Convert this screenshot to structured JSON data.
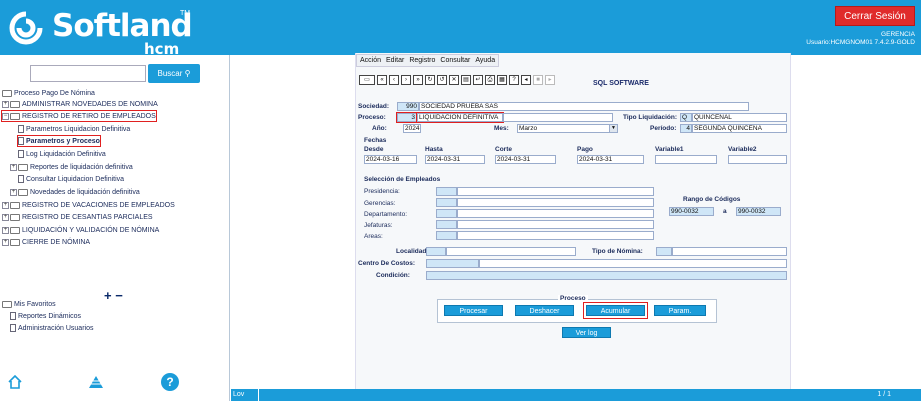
{
  "app": {
    "logo_text": "Softland",
    "logo_sub": "hcm",
    "logout": "Cerrar Sesión",
    "company": "GERENCIA",
    "user_line": "Usuario:HCMGNOM01 7.4.2.9-GOLD"
  },
  "sidebar": {
    "search_button": "Buscar",
    "root": "Proceso Pago De Nómina",
    "items": [
      "ADMINISTRAR NOVEDADES DE NOMINA",
      "REGISTRO DE RETIRO DE EMPLEADOS",
      "Parametros Liquidacion Definitiva",
      "Parametros y Proceso",
      "Log Liquidación Definitiva",
      "Reportes de liquidación definitiva",
      "Consultar Liquidacion Definitiva",
      "Novedades de liquidación definitiva",
      "REGISTRO DE VACACIONES DE EMPLEADOS",
      "REGISTRO DE CESANTIAS PARCIALES",
      "LIQUIDACIÓN Y VALIDACIÓN DE NÓMINA",
      "CIERRE DE NÓMINA"
    ],
    "favorites_title": "Mis Favoritos",
    "favorites": [
      "Reportes Dinámicos",
      "Administración Usuarios"
    ]
  },
  "menu": [
    "Acción",
    "Editar",
    "Registro",
    "Consultar",
    "Ayuda"
  ],
  "toolbar_title": "SQL SOFTWARE",
  "form": {
    "sociedad_label": "Sociedad:",
    "sociedad_code": "990",
    "sociedad_name": "SOCIEDAD  PRUEBA SAS",
    "proceso_label": "Proceso:",
    "proceso_code": "3",
    "proceso_name": "LIQUIDACION DEFINITIVA",
    "tipo_liq_label": "Tipo Liquidación:",
    "tipo_liq_code": "Q",
    "tipo_liq_name": "QUINCENAL",
    "anio_label": "Año:",
    "anio": "2024",
    "mes_label": "Mes:",
    "mes": "Marzo",
    "periodo_label": "Período:",
    "periodo_code": "4",
    "periodo_name": "SEGUNDA QUINCENA",
    "fechas_label": "Fechas",
    "desde_label": "Desde",
    "desde": "2024-03-16",
    "hasta_label": "Hasta",
    "hasta": "2024-03-31",
    "corte_label": "Corte",
    "corte": "2024-03-31",
    "pago_label": "Pago",
    "pago": "2024-03-31",
    "variable1_label": "Variable1",
    "variable2_label": "Variable2",
    "seleccion_label": "Selección de Empleados",
    "presidencia_label": "Presidencia:",
    "gerencias_label": "Gerencias:",
    "departamento_label": "Departamento:",
    "jefaturas_label": "Jefaturas:",
    "areas_label": "Areas:",
    "rango_label": "Rango de Códigos",
    "rango_desde": "990-0032",
    "rango_a": "a",
    "rango_hasta": "990-0032",
    "localidad_label": "Localidad:",
    "tipo_nomina_label": "Tipo de Nómina:",
    "centro_costos_label": "Centro De Costos:",
    "condicion_label": "Condición:",
    "proceso_group": "Proceso",
    "btn_procesar": "Procesar",
    "btn_deshacer": "Deshacer",
    "btn_acumular": "Acumular",
    "btn_param": "Param.",
    "btn_verlog": "Ver log"
  },
  "footer": {
    "left": "Lov",
    "right": "1 / 1"
  }
}
